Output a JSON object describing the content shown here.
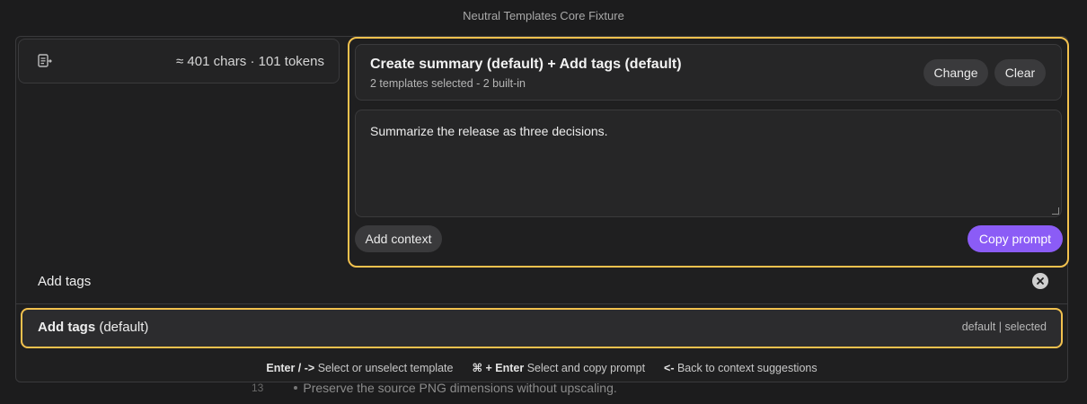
{
  "window": {
    "title": "Neutral Templates Core Fixture"
  },
  "editor_behind": {
    "line_number": "13",
    "line_text": "Preserve the source PNG dimensions without upscaling."
  },
  "stats": {
    "icon": "document-arrow-icon",
    "text": "≈ 401 chars · 101 tokens"
  },
  "composer": {
    "summary_title": "Create summary (default) + Add tags (default)",
    "summary_subtitle": "2 templates selected - 2 built-in",
    "change_label": "Change",
    "clear_label": "Clear",
    "prompt_text": "Summarize the release as three decisions.",
    "add_context_label": "Add context",
    "copy_prompt_label": "Copy prompt"
  },
  "search": {
    "value": "Add tags",
    "clear_icon": "close-circle-icon"
  },
  "results": [
    {
      "name": "Add tags",
      "suffix": "(default)",
      "meta": "default | selected"
    }
  ],
  "hints": {
    "h1_key": "Enter / ->",
    "h1_text": "Select or unselect template",
    "h2_key": "⌘ + Enter",
    "h2_text": "Select and copy prompt",
    "h3_key": "<-",
    "h3_text": "Back to context suggestions"
  },
  "colors": {
    "accent_outline": "#f2c14e",
    "primary_button": "#8b5cf6"
  }
}
